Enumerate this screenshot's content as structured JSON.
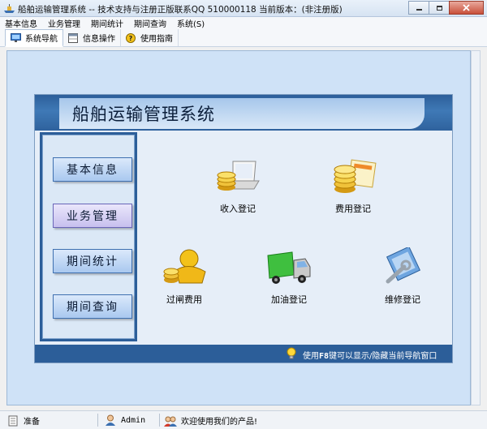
{
  "window": {
    "title": "船舶运输管理系统 -- 技术支持与注册正版联系QQ 510000118    当前版本：(非注册版)"
  },
  "menubar": {
    "items": [
      "基本信息",
      "业务管理",
      "期间统计",
      "期间查询",
      "系统(S)"
    ]
  },
  "tabs": [
    {
      "label": "系统导航",
      "icon": "monitor-icon",
      "active": true
    },
    {
      "label": "信息操作",
      "icon": "grid-icon",
      "active": false
    },
    {
      "label": "使用指南",
      "icon": "help-icon",
      "active": false
    }
  ],
  "panel": {
    "title": "船舶运输管理系统",
    "nav": [
      {
        "label": "基本信息",
        "selected": false
      },
      {
        "label": "业务管理",
        "selected": true
      },
      {
        "label": "期间统计",
        "selected": false
      },
      {
        "label": "期间查询",
        "selected": false
      }
    ],
    "features": [
      {
        "label": "收入登记",
        "icon": "laptop-coins-icon"
      },
      {
        "label": "费用登记",
        "icon": "bills-coins-icon"
      },
      {
        "label": "过闸费用",
        "icon": "gold-bag-icon"
      },
      {
        "label": "加油登记",
        "icon": "truck-icon"
      },
      {
        "label": "维修登记",
        "icon": "repair-tools-icon"
      }
    ],
    "hint": {
      "prefix": "使用",
      "key": "F8",
      "suffix": "键可以显示/隐藏当前导航窗口"
    }
  },
  "statusbar": {
    "ready": "准备",
    "user": "Admin",
    "welcome": "欢迎使用我们的产品!"
  },
  "colors": {
    "header_blue": "#2d5f9a",
    "panel_bg": "#e6eef8",
    "workspace_bg": "#cfe2f7",
    "nav_button": "#a9c8ef",
    "nav_button_selected": "#c7c0ee"
  }
}
